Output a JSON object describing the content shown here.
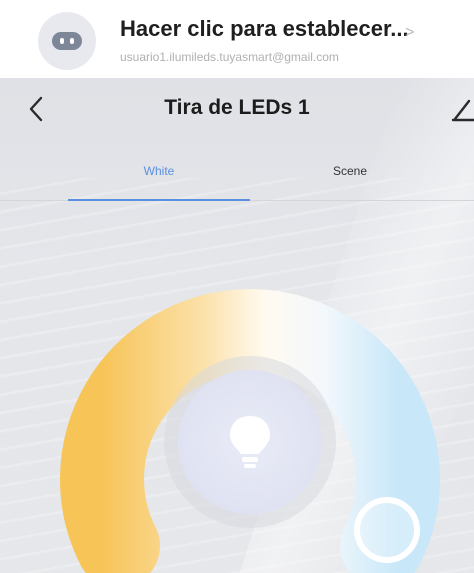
{
  "account": {
    "title": "Hacer clic para establecer...",
    "chevron": ">",
    "email": "usuario1.ilumileds.tuyasmart@gmail.com"
  },
  "device": {
    "title": "Tira de LEDs 1",
    "tabs": [
      {
        "label": "White",
        "active": true
      },
      {
        "label": "Scene",
        "active": false
      }
    ]
  },
  "colors": {
    "accent": "#5b8fe0",
    "warm": "#f8c96a",
    "cool": "#cfe9f7"
  },
  "icons": {
    "back": "chevron-left-icon",
    "edit": "pencil-icon",
    "bulb": "light-bulb-icon"
  }
}
